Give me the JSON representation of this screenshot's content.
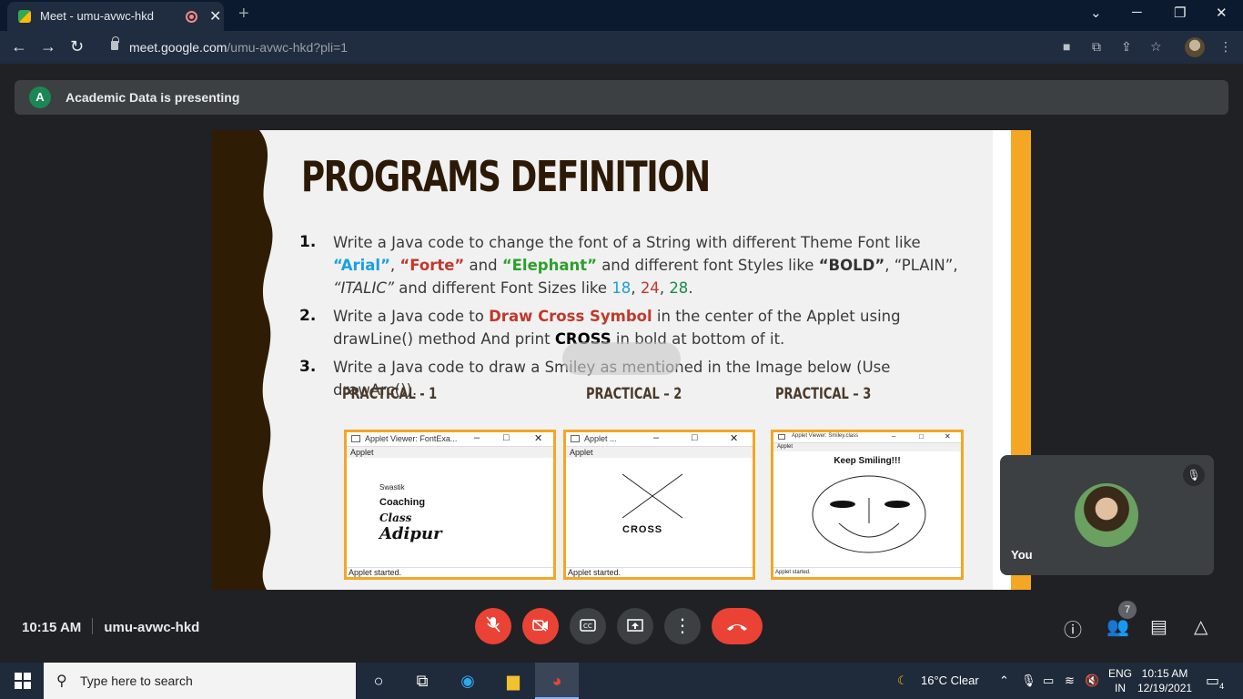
{
  "browser": {
    "tab_title": "Meet - umu-avwc-hkd",
    "tab_close": "✕",
    "new_tab": "+",
    "url_host": "meet.google.com",
    "url_path": "/umu-avwc-hkd?pli=1"
  },
  "meet": {
    "presenter_initial": "A",
    "presenting_text": "Academic Data is presenting",
    "self_name": "You",
    "clock_time": "10:15 AM",
    "meeting_code": "umu-avwc-hkd",
    "people_count": "7"
  },
  "slide": {
    "title": "PROGRAMS DEFINITION",
    "items": [
      {
        "num": "1."
      },
      {
        "num": "2."
      },
      {
        "num": "3."
      }
    ],
    "item1": {
      "t1": "Write a Java code to change the font of a String with different Theme Font like ",
      "arial": "“Arial”",
      "c1": ",",
      "forte": "“Forte”",
      "t2": " and ",
      "elephant": "“Elephant”",
      "t3": " and different font Styles like ",
      "bold": "“BOLD”",
      "t4": ", “PLAIN”, ",
      "italic": "“ITALIC”",
      "t5": " and different Font Sizes like ",
      "s18": "18",
      "c2": ", ",
      "s24": "24",
      "c3": ", ",
      "s28": "28",
      "t6": "."
    },
    "item2": {
      "t1": "Write a Java code to ",
      "draw": "Draw Cross Symbol",
      "t2": " in the center of the Applet using drawLine() method And print ",
      "cross": "CROSS",
      "t3": " in bold at bottom of it."
    },
    "item3": {
      "t1": "Write a Java code to draw a Smiley as mentioned in the Image below (Use drawArc())."
    },
    "practicals": [
      "PRACTICAL  - 1",
      "PRACTICAL – 2",
      "PRACTICAL – 3"
    ],
    "applet1": {
      "title": "Applet Viewer: FontExa...",
      "menu": "Applet",
      "swastik": "Swastik",
      "coaching": "Coaching",
      "class": "Class",
      "adipur": "Adipur",
      "status": "Applet started."
    },
    "applet2": {
      "title": "Applet ...",
      "menu": "Applet",
      "cross": "CROSS",
      "status": "Applet started."
    },
    "applet3": {
      "title": "Applet Viewer: Smiley.class",
      "menu": "Applet",
      "keep": "Keep Smiling!!!",
      "status": "Applet started."
    }
  },
  "taskbar": {
    "search_placeholder": "Type here to search",
    "weather": "16°C  Clear",
    "lang1": "ENG",
    "lang2": "IN",
    "time": "10:15 AM",
    "date": "12/19/2021",
    "notif_count": "4"
  },
  "colors": {
    "accent_red": "#ea4335",
    "slide_orange": "#f5a623",
    "slide_brown": "#2c1a06"
  }
}
